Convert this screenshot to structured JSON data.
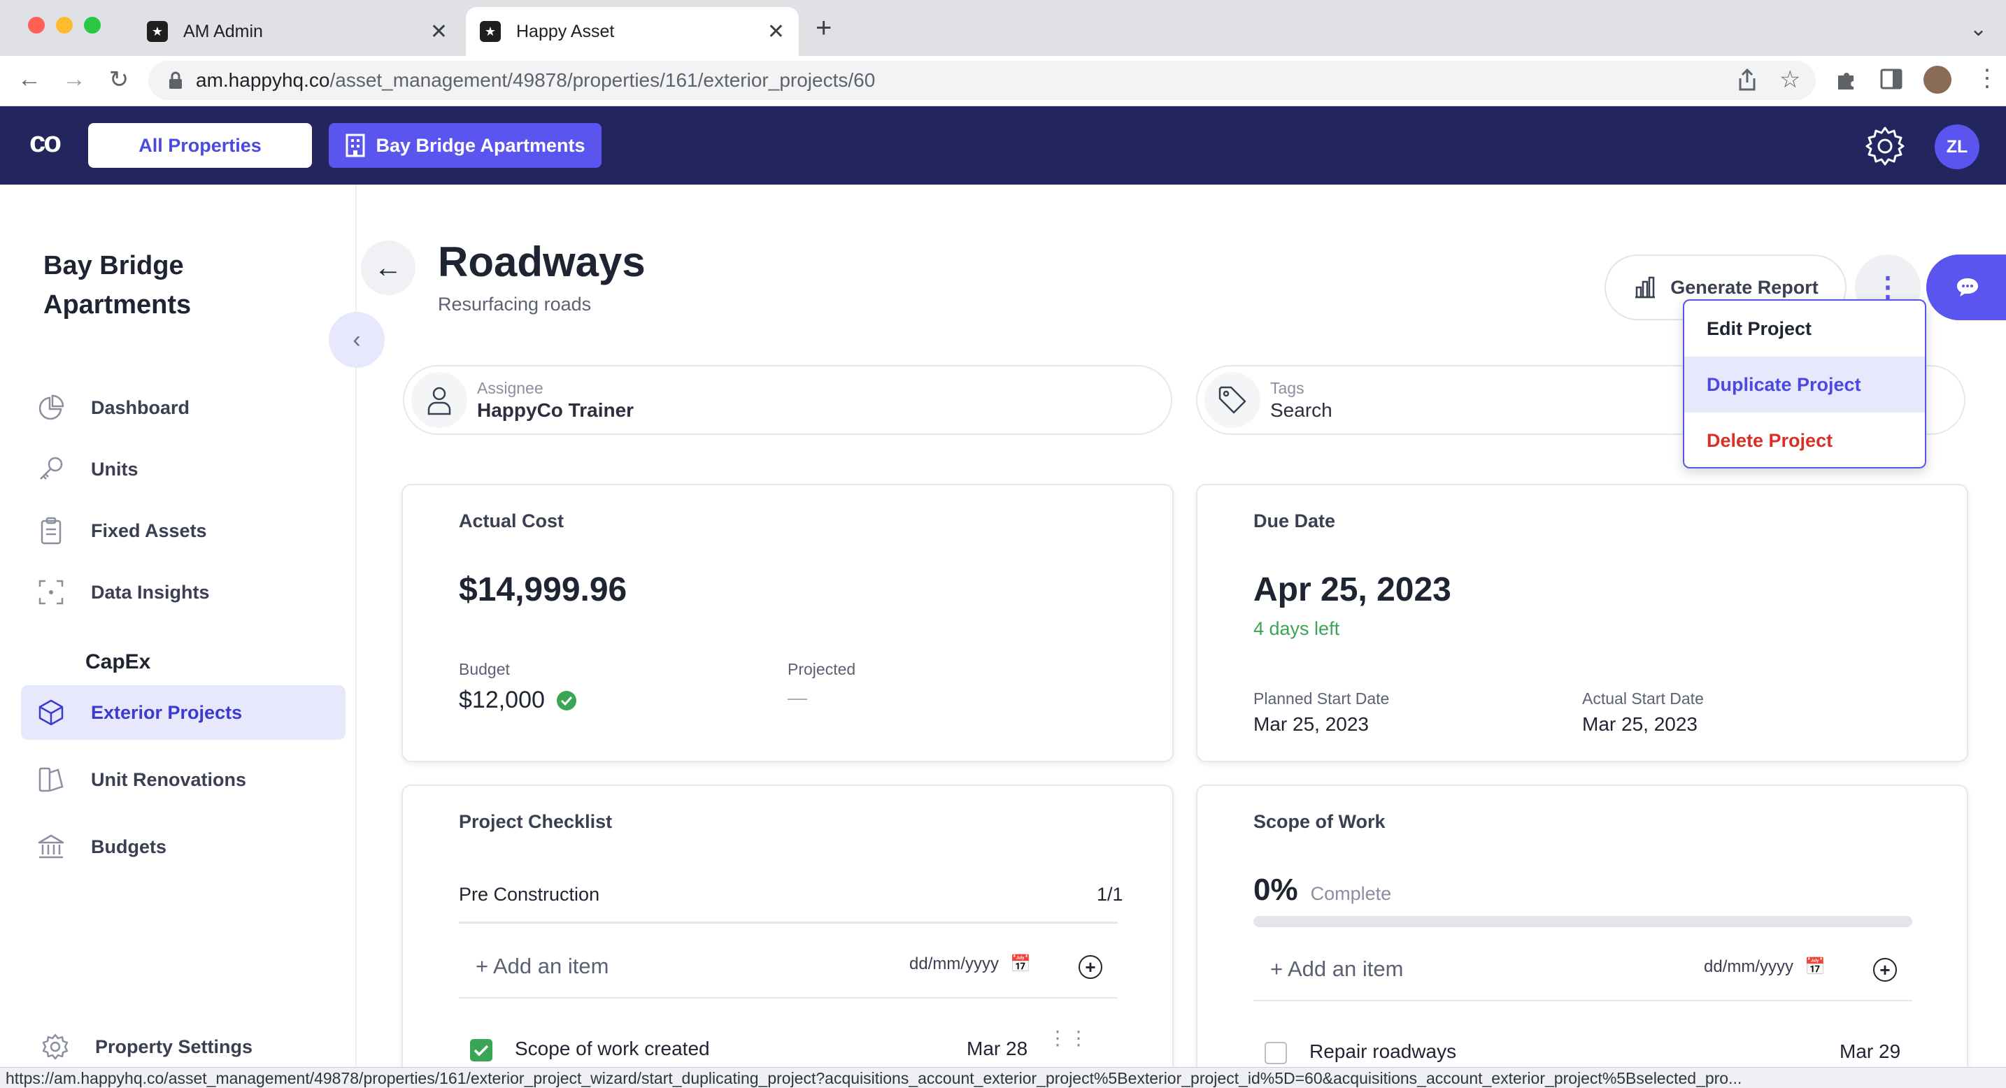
{
  "browser": {
    "tabs": [
      {
        "title": "AM Admin",
        "close": "✕"
      },
      {
        "title": "Happy Asset",
        "close": "✕"
      }
    ],
    "new_tab": "+",
    "url_host": "am.happyhq.co",
    "url_path": "/asset_management/49878/properties/161/exterior_projects/60",
    "status_url": "https://am.happyhq.co/asset_management/49878/properties/161/exterior_project_wizard/start_duplicating_project?acquisitions_account_exterior_project%5Bexterior_project_id%5D=60&acquisitions_account_exterior_project%5Bselected_pro..."
  },
  "header": {
    "logo": "co",
    "all_properties": "All Properties",
    "property_button": "Bay Bridge Apartments",
    "avatar_initials": "ZL"
  },
  "sidebar": {
    "property_name": "Bay Bridge Apartments",
    "items": [
      {
        "label": "Dashboard",
        "icon": "pie-chart-icon"
      },
      {
        "label": "Units",
        "icon": "key-icon"
      },
      {
        "label": "Fixed Assets",
        "icon": "clipboard-icon"
      },
      {
        "label": "Data Insights",
        "icon": "insights-icon"
      }
    ],
    "section_capex": "CapEx",
    "capex_items": [
      {
        "label": "Exterior Projects",
        "icon": "cube-icon",
        "active": true
      },
      {
        "label": "Unit Renovations",
        "icon": "renovation-icon"
      },
      {
        "label": "Budgets",
        "icon": "bank-icon"
      }
    ],
    "settings_label": "Property Settings"
  },
  "project": {
    "title": "Roadways",
    "subtitle": "Resurfacing roads",
    "generate_report": "Generate Report",
    "assignee_label": "Assignee",
    "assignee_value": "HappyCo Trainer",
    "tags_label": "Tags",
    "tags_value": "Search"
  },
  "menu": {
    "items": [
      "Edit Project",
      "Duplicate Project",
      "Delete Project"
    ],
    "highlighted": "Duplicate Project"
  },
  "cost_card": {
    "title": "Actual Cost",
    "amount": "$14,999.96",
    "budget_label": "Budget",
    "budget_value": "$12,000",
    "projected_label": "Projected",
    "projected_value": "—"
  },
  "due_card": {
    "title": "Due Date",
    "date": "Apr 25, 2023",
    "days_left": "4 days left",
    "planned_label": "Planned Start Date",
    "planned_value": "Mar 25, 2023",
    "actual_label": "Actual Start Date",
    "actual_value": "Mar 25, 2023"
  },
  "checklist_card": {
    "title": "Project Checklist",
    "section": "Pre Construction",
    "count": "1/1",
    "add_item": "+ Add an item",
    "date_placeholder": "dd/mm/yyyy",
    "items": [
      {
        "label": "Scope of work created",
        "date": "Mar 28",
        "checked": true
      }
    ]
  },
  "scope_card": {
    "title": "Scope of Work",
    "percent": "0%",
    "percent_label": "Complete",
    "progress": 0,
    "add_item": "+ Add an item",
    "date_placeholder": "dd/mm/yyyy",
    "items": [
      {
        "label": "Repair roadways",
        "date": "Mar 29",
        "checked": false
      }
    ]
  },
  "colors": {
    "brand_navy": "#23255e",
    "accent": "#5b55f0",
    "danger": "#d93025",
    "success": "#3aa655"
  }
}
